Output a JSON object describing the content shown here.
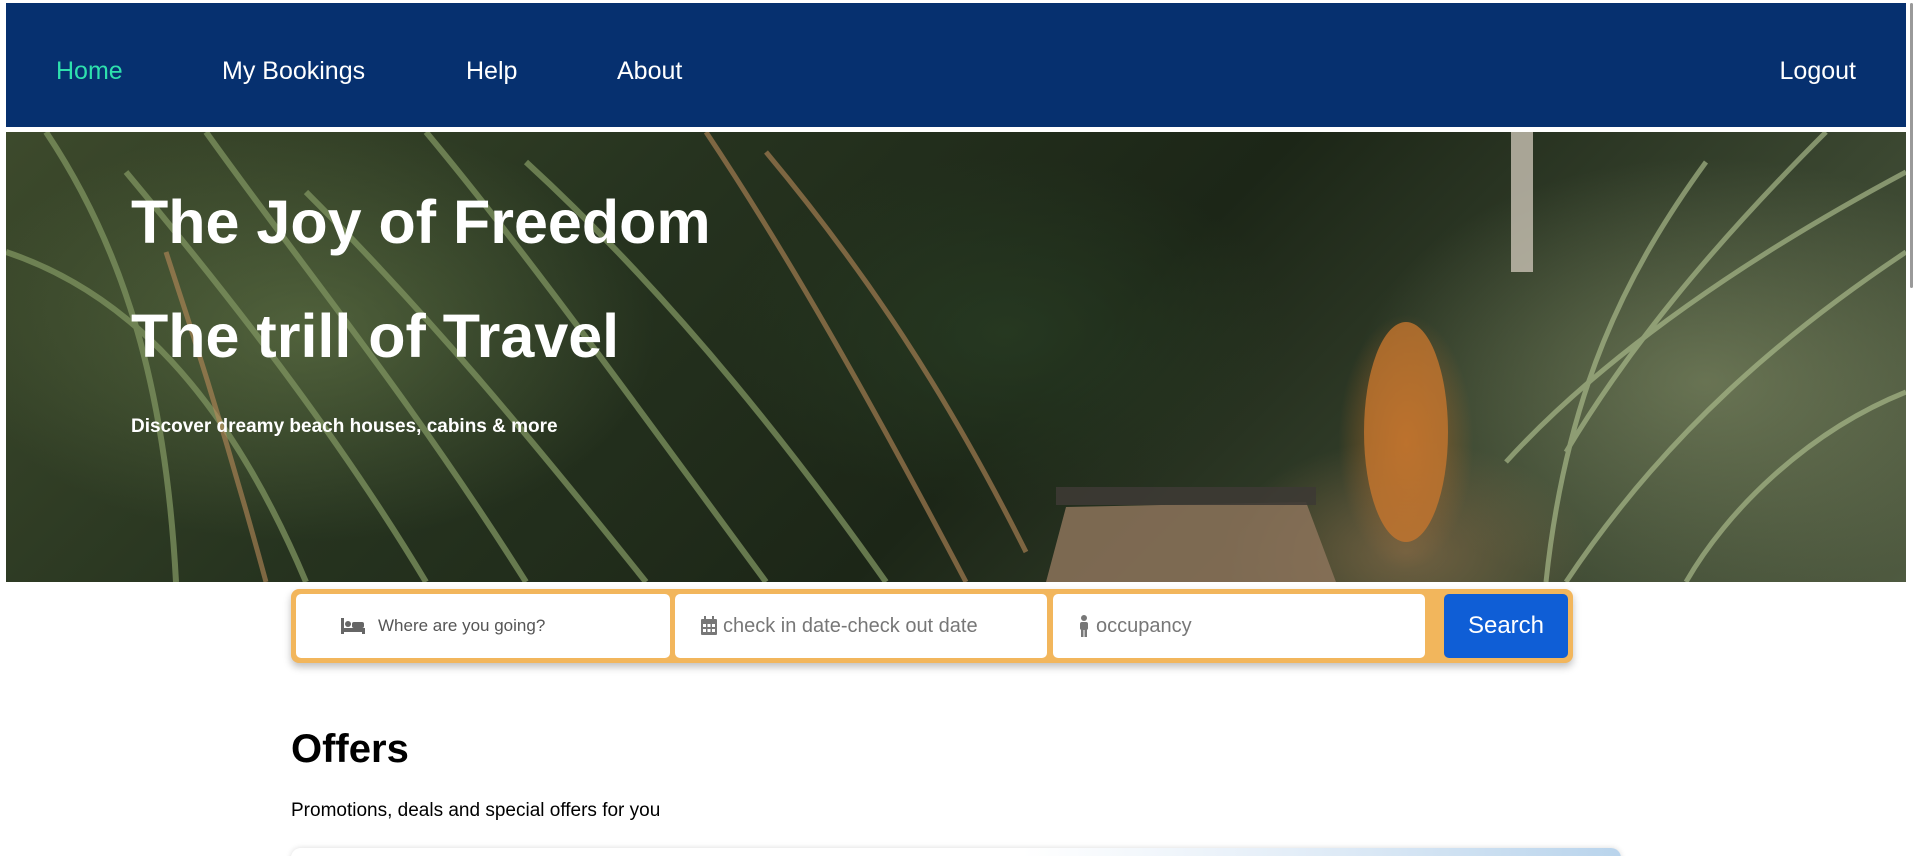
{
  "nav": {
    "items": [
      {
        "label": "Home",
        "active": true
      },
      {
        "label": "My Bookings",
        "active": false
      },
      {
        "label": "Help",
        "active": false
      },
      {
        "label": "About",
        "active": false
      }
    ],
    "logout_label": "Logout"
  },
  "hero": {
    "title_line1": "The Joy of Freedom",
    "title_line2": "The trill of Travel",
    "subtitle": "Discover dreamy beach houses, cabins & more"
  },
  "search": {
    "destination_placeholder": "Where are you going?",
    "dates_placeholder": "check in date-check out date",
    "occupancy_placeholder": "occupancy",
    "button_label": "Search",
    "icons": {
      "destination": "bed-icon",
      "dates": "calendar-icon",
      "occupancy": "person-icon"
    }
  },
  "offers": {
    "title": "Offers",
    "subtitle": "Promotions, deals and special offers for you"
  },
  "colors": {
    "navbar_bg": "#06306f",
    "active_link": "#2ee0ad",
    "search_frame": "#f2b65c",
    "search_button": "#0f5ed6"
  }
}
